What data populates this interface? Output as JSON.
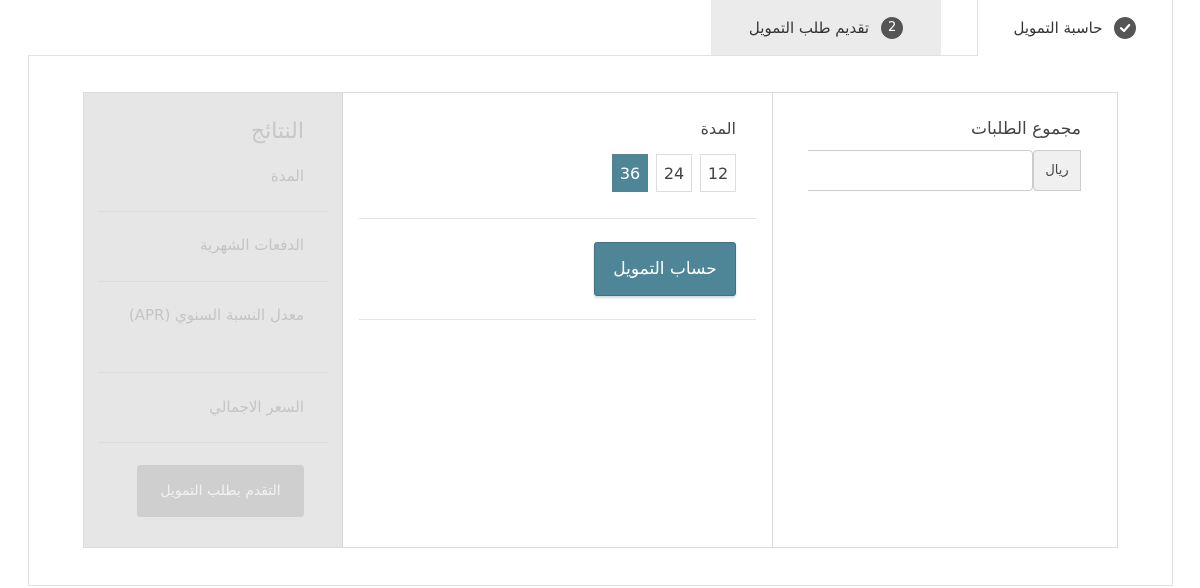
{
  "tabs": {
    "calculator": {
      "label": "حاسبة التمويل",
      "icon": "check-circle-icon"
    },
    "apply": {
      "label": "تقديم طلب التمويل",
      "step": "2"
    }
  },
  "amount": {
    "label": "مجموع الطلبات",
    "currency": "ريال",
    "value": ""
  },
  "term": {
    "label": "المدة",
    "options": [
      "12",
      "24",
      "36"
    ],
    "selected": "36"
  },
  "calculate_button": "حساب التمويل",
  "results": {
    "title": "النتائج",
    "term_label": "المدة",
    "monthly_payments_label": "الدفعات الشهرية",
    "apr_label": "معدل النسبة السنوي (APR)",
    "total_price_label": "السعر الاجمالي",
    "proceed_button": "التقدم بطلب التمويل"
  },
  "colors": {
    "accent": "#4e8597",
    "results_bg": "#e6e6e6",
    "tab_inactive_bg": "#ebebeb"
  }
}
